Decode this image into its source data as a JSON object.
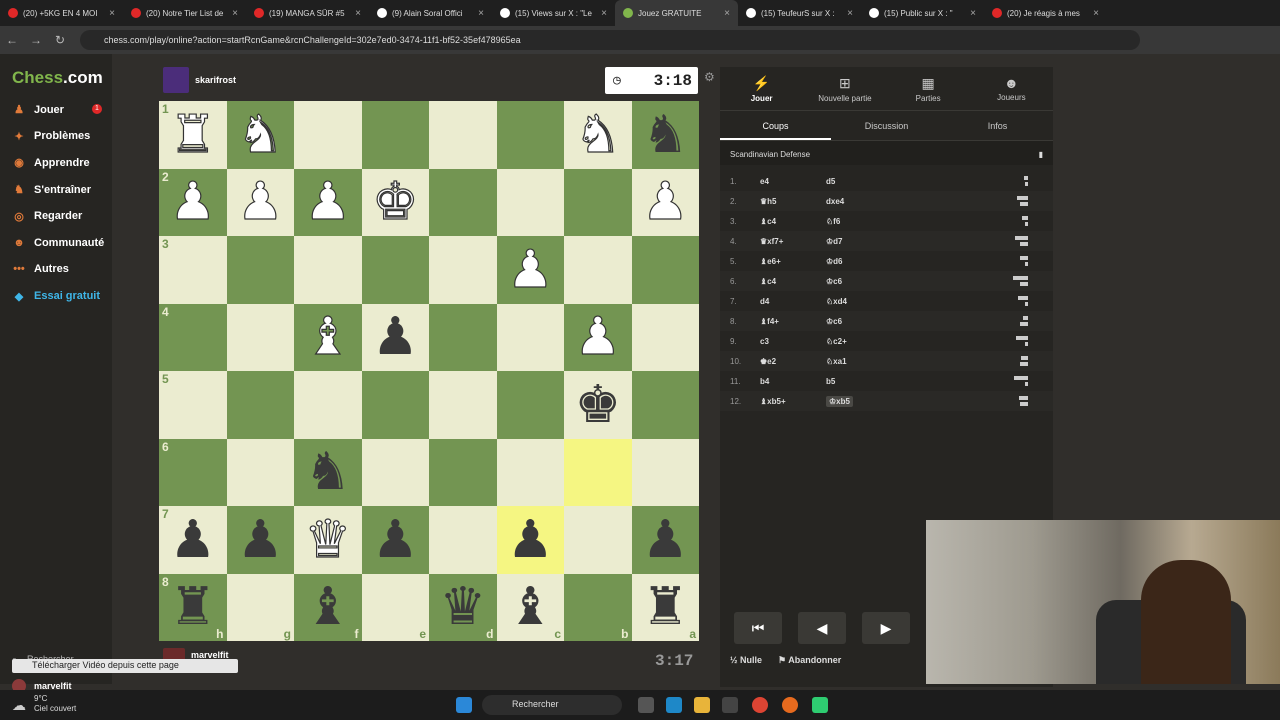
{
  "browser": {
    "tabs": [
      {
        "label": "(20) +5KG EN 4 MOI",
        "color": "#e02828"
      },
      {
        "label": "(20) Notre Tier List de",
        "color": "#e02828"
      },
      {
        "label": "(19) MANGA SÛR #5",
        "color": "#e02828"
      },
      {
        "label": "(9) Alain Soral Offici",
        "color": "#ffffff"
      },
      {
        "label": "(15) Views sur X : \"Le",
        "color": "#ffffff"
      },
      {
        "label": "Jouez GRATUITE",
        "color": "#81b64c"
      },
      {
        "label": "(15) TeufeurS sur X :",
        "color": "#ffffff"
      },
      {
        "label": "(15) Public sur X : \"",
        "color": "#ffffff"
      },
      {
        "label": "(20) Je réagis à mes",
        "color": "#e02828"
      }
    ],
    "url": "chess.com/play/online?action=startRcnGame&rcnChallengeId=302e7ed0-3474-11f1-bf52-35ef478965ea"
  },
  "sidebar": {
    "logo_a": "Chess",
    "logo_b": ".com",
    "items": [
      {
        "label": "Jouer",
        "icon": "pawn-icon",
        "glyph": "♟"
      },
      {
        "label": "Problèmes",
        "icon": "puzzle-icon",
        "glyph": "✦"
      },
      {
        "label": "Apprendre",
        "icon": "learn-icon",
        "glyph": "◉"
      },
      {
        "label": "S'entraîner",
        "icon": "train-icon",
        "glyph": "♞"
      },
      {
        "label": "Regarder",
        "icon": "watch-icon",
        "glyph": "◎"
      },
      {
        "label": "Communauté",
        "icon": "community-icon",
        "glyph": "☻"
      },
      {
        "label": "Autres",
        "icon": "more-icon",
        "glyph": "•••"
      },
      {
        "label": "Essai gratuit",
        "icon": "diamond-icon",
        "glyph": "◆"
      }
    ],
    "badge": "1",
    "search_label": "Rechercher",
    "user": "marvelfit"
  },
  "game": {
    "top_player": "skarifrost",
    "top_clock": "3:18",
    "bottom_player": "marvelfit",
    "bottom_clock": "3:17",
    "ranks": [
      "1",
      "2",
      "3",
      "4",
      "5",
      "6",
      "7",
      "8"
    ],
    "files": [
      "h",
      "g",
      "f",
      "e",
      "d",
      "c",
      "b",
      "a"
    ],
    "board": [
      [
        "wR",
        "wN",
        "",
        "",
        "",
        "",
        "wN",
        "bN"
      ],
      [
        "wP",
        "wP",
        "wP",
        "wK",
        "",
        "",
        "",
        "wP"
      ],
      [
        "",
        "",
        "",
        "",
        "",
        "wP",
        "",
        ""
      ],
      [
        "",
        "",
        "wB",
        "bP",
        "",
        "",
        "wP",
        ""
      ],
      [
        "",
        "",
        "",
        "",
        "",
        "",
        "bK",
        ""
      ],
      [
        "",
        "",
        "bN",
        "",
        "",
        "",
        "",
        ""
      ],
      [
        "bP",
        "bP",
        "wQ",
        "bP",
        "",
        "bP",
        "",
        "bP"
      ],
      [
        "bR",
        "",
        "bB",
        "",
        "bQ",
        "bB",
        "",
        "bR"
      ]
    ],
    "highlight": [
      "5-6",
      "6-5"
    ]
  },
  "panel": {
    "tabs": [
      {
        "label": "Jouer",
        "icon": "lightning-icon",
        "glyph": "⚡"
      },
      {
        "label": "Nouvelle partie",
        "icon": "plus-icon",
        "glyph": "⊞"
      },
      {
        "label": "Parties",
        "icon": "board-icon",
        "glyph": "▦"
      },
      {
        "label": "Joueurs",
        "icon": "players-icon",
        "glyph": "☻"
      }
    ],
    "subtabs": [
      "Coups",
      "Discussion",
      "Infos"
    ],
    "opening": "Scandinavian Defense",
    "moves": [
      {
        "n": "1.",
        "w": "e4",
        "b": "d5"
      },
      {
        "n": "2.",
        "w": "♛h5",
        "b": "dxe4"
      },
      {
        "n": "3.",
        "w": "♝c4",
        "b": "♘f6"
      },
      {
        "n": "4.",
        "w": "♛xf7+",
        "b": "♔d7"
      },
      {
        "n": "5.",
        "w": "♝e6+",
        "b": "♔d6"
      },
      {
        "n": "6.",
        "w": "♝c4",
        "b": "♔c6"
      },
      {
        "n": "7.",
        "w": "d4",
        "b": "♘xd4"
      },
      {
        "n": "8.",
        "w": "♝f4+",
        "b": "♔c6"
      },
      {
        "n": "9.",
        "w": "c3",
        "b": "♘c2+"
      },
      {
        "n": "10.",
        "w": "♚e2",
        "b": "♘xa1"
      },
      {
        "n": "11.",
        "w": "b4",
        "b": "b5"
      },
      {
        "n": "12.",
        "w": "♝xb5+",
        "b": "♔xb5"
      }
    ],
    "draw_label": "Nulle",
    "resign_label": "Abandonner"
  },
  "download_bar": "Télécharger Vidéo depuis cette page",
  "taskbar": {
    "temp": "9°C",
    "weather": "Ciel couvert",
    "search": "Rechercher"
  }
}
